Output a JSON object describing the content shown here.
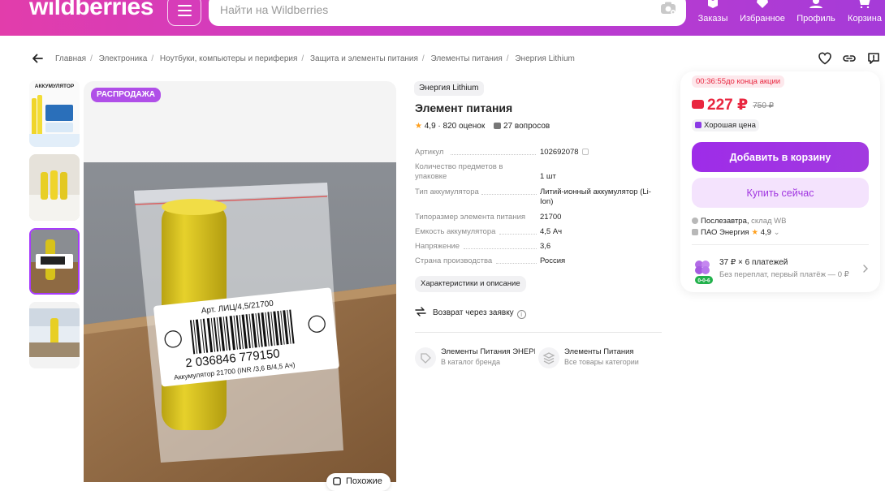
{
  "header": {
    "logo": "wildberries",
    "search_placeholder": "Найти на Wildberries",
    "nav": [
      {
        "label": "Заказы",
        "icon": "box-icon"
      },
      {
        "label": "Избранное",
        "icon": "heart-icon"
      },
      {
        "label": "Профиль",
        "icon": "user-icon"
      },
      {
        "label": "Корзина",
        "icon": "cart-icon"
      }
    ],
    "accent": "#cb11ab"
  },
  "breadcrumbs": [
    "Главная",
    "Электроника",
    "Ноутбуки, компьютеры и периферия",
    "Защита и элементы питания",
    "Элементы питания",
    "Энергия Lithium"
  ],
  "gallery": {
    "sale_badge": "РАСПРОДАЖА",
    "similar_label": "Похожие",
    "thumb1_text": "АККУМУЛЯТОР",
    "photo": {
      "label_text": "Арт. ЛИЦ/4,5/21700",
      "barcode_number": "2 036846 779150",
      "caption": "Аккумулятор 21700 (INR /3,6 В/4,5 Ач)"
    }
  },
  "product": {
    "brand": "Энергия Lithium",
    "title": "Элемент питания",
    "rating": "4,9",
    "reviews": "820 оценок",
    "questions": "27 вопросов",
    "specs": [
      {
        "key": "Артикул",
        "value": "102692078"
      },
      {
        "key": "Количество предметов в упаковке",
        "value": "1 шт"
      },
      {
        "key": "Тип аккумулятора",
        "value": "Литий-ионный аккумулятор (Li-Ion)"
      },
      {
        "key": "Типоразмер элемента питания",
        "value": "21700"
      },
      {
        "key": "Емкость аккумулятора",
        "value": "4,5 Ач"
      },
      {
        "key": "Напряжение",
        "value": "3,6"
      },
      {
        "key": "Страна производства",
        "value": "Россия"
      }
    ],
    "characteristics_button": "Характеристики и описание",
    "return_text": "Возврат через заявку",
    "links": [
      {
        "title": "Элементы Питания ЭНЕРГИЯ",
        "subtitle": "В каталог бренда"
      },
      {
        "title": "Элементы Питания",
        "subtitle": "Все товары категории"
      }
    ]
  },
  "buybox": {
    "timer": "00:36:55",
    "timer_suffix": "до конца акции",
    "price": "227 ₽",
    "old_price": "750 ₽",
    "good_price": "Хорошая цена",
    "add_to_cart": "Добавить в корзину",
    "buy_now": "Купить сейчас",
    "delivery": "Послезавтра,",
    "warehouse": "склад WB",
    "seller": "ПАО Энергия",
    "seller_rating": "4,9",
    "installment_title": "37 ₽ × 6 платежей",
    "installment_subtitle": "Без переплат, первый платёж — 0 ₽",
    "installment_badge": "0-0-6",
    "price_color": "#f0213d",
    "button_color": "#a73afd"
  }
}
